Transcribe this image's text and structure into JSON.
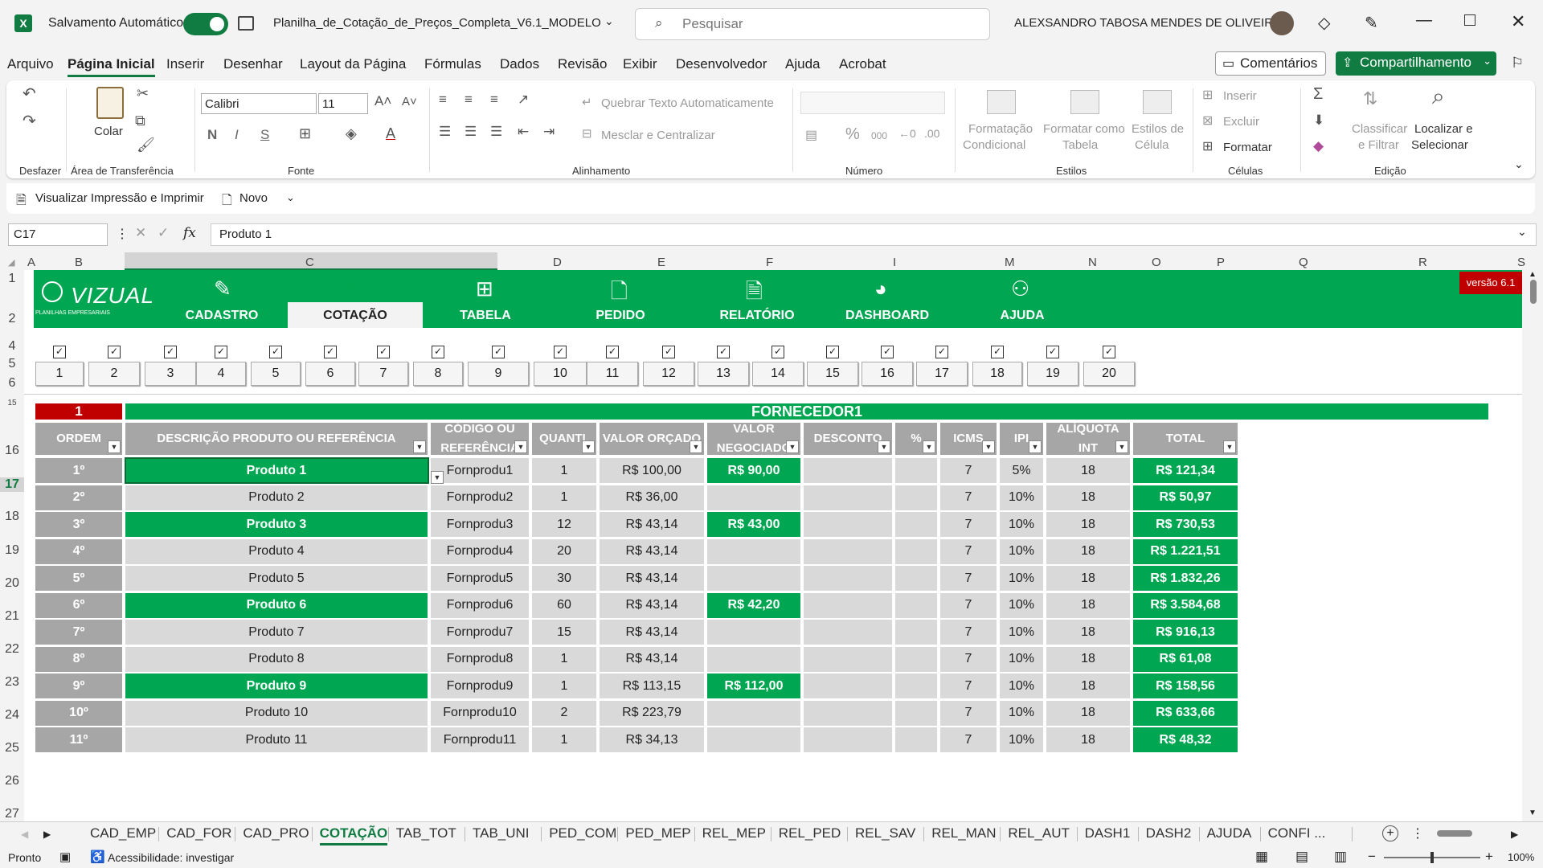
{
  "titlebar": {
    "autosave_label": "Salvamento Automático",
    "filename": "Planilha_de_Cotação_de_Preços_Completa_V6.1_MODELO.xl...",
    "search_placeholder": "Pesquisar",
    "user_name": "ALEXSANDRO TABOSA MENDES DE OLIVEIRA"
  },
  "menu": [
    "Arquivo",
    "Página Inicial",
    "Inserir",
    "Desenhar",
    "Layout da Página",
    "Fórmulas",
    "Dados",
    "Revisão",
    "Exibir",
    "Desenvolvedor",
    "Ajuda",
    "Acrobat"
  ],
  "menu_active": "Página Inicial",
  "actions": {
    "comments": "Comentários",
    "share": "Compartilhamento"
  },
  "ribbon": {
    "undo_group": "Desfazer",
    "clipboard": {
      "paste": "Colar",
      "group": "Área de Transferência"
    },
    "font": {
      "name": "Calibri",
      "size": "11",
      "group": "Fonte",
      "bold": "N",
      "italic": "I",
      "underline": "S"
    },
    "alignment": {
      "wrap": "Quebrar Texto Automaticamente",
      "merge": "Mesclar e Centralizar",
      "group": "Alinhamento"
    },
    "number": {
      "group": "Número",
      "percent": "%",
      "thousands": "000"
    },
    "styles": {
      "cond_line1": "Formatação",
      "cond_line2": "Condicional",
      "table_line1": "Formatar como",
      "table_line2": "Tabela",
      "cell_line1": "Estilos de",
      "cell_line2": "Célula",
      "group": "Estilos"
    },
    "cells": {
      "insert": "Inserir",
      "delete": "Excluir",
      "format": "Formatar",
      "group": "Células"
    },
    "editing": {
      "sort_line1": "Classificar",
      "sort_line2": "e Filtrar",
      "find_line1": "Localizar e",
      "find_line2": "Selecionar",
      "group": "Edição"
    }
  },
  "qat": {
    "print_preview": "Visualizar Impressão e Imprimir",
    "new": "Novo"
  },
  "formula": {
    "namebox": "C17",
    "fx": "fx",
    "value": "Produto 1"
  },
  "columns": [
    "A",
    "B",
    "C",
    "D",
    "E",
    "F",
    "I",
    "M",
    "N",
    "O",
    "P",
    "Q",
    "R",
    "S"
  ],
  "rows_left": [
    "1",
    "2",
    "4",
    "5",
    "6",
    "15",
    "16",
    "17",
    "18",
    "19",
    "20",
    "21",
    "22",
    "23",
    "24",
    "25",
    "26",
    "27"
  ],
  "nav": {
    "logo": "VIZUAL",
    "logo_sub": "PLANILHAS EMPRESARIAIS",
    "items": [
      "CADASTRO",
      "COTAÇÃO",
      "TABELA",
      "PEDIDO",
      "RELATÓRIO",
      "DASHBOARD",
      "AJUDA"
    ],
    "version": "versão 6.1"
  },
  "selectors": [
    "1",
    "2",
    "3",
    "4",
    "5",
    "6",
    "7",
    "8",
    "9",
    "10",
    "11",
    "12",
    "13",
    "14",
    "15",
    "16",
    "17",
    "18",
    "19",
    "20"
  ],
  "quote": {
    "supplier_number": "1",
    "supplier_title": "FORNECEDOR1",
    "headers": [
      "ORDEM",
      "DESCRIÇÃO PRODUTO OU REFERÊNCIA",
      "CÓDIGO OU REFERÊNCIA",
      "QUANTI.",
      "VALOR ORÇADO",
      "VALOR NEGOCIADO",
      "DESCONTO",
      "%",
      "ICMS",
      "IPI",
      "ALÍQUOTA INT",
      "TOTAL"
    ],
    "rows": [
      {
        "ordem": "1º",
        "desc": "Produto 1",
        "codigo": "Fornprodu1",
        "qtd": "1",
        "orcado": "R$ 100,00",
        "negociado": "R$ 90,00",
        "desconto": "",
        "pct": "",
        "icms": "7",
        "ipi": "5%",
        "aliq": "18",
        "total": "R$ 121,34",
        "hl": true
      },
      {
        "ordem": "2º",
        "desc": "Produto 2",
        "codigo": "Fornprodu2",
        "qtd": "1",
        "orcado": "R$ 36,00",
        "negociado": "",
        "desconto": "",
        "pct": "",
        "icms": "7",
        "ipi": "10%",
        "aliq": "18",
        "total": "R$ 50,97",
        "hl": false
      },
      {
        "ordem": "3º",
        "desc": "Produto 3",
        "codigo": "Fornprodu3",
        "qtd": "12",
        "orcado": "R$ 43,14",
        "negociado": "R$ 43,00",
        "desconto": "",
        "pct": "",
        "icms": "7",
        "ipi": "10%",
        "aliq": "18",
        "total": "R$ 730,53",
        "hl": true
      },
      {
        "ordem": "4º",
        "desc": "Produto 4",
        "codigo": "Fornprodu4",
        "qtd": "20",
        "orcado": "R$ 43,14",
        "negociado": "",
        "desconto": "",
        "pct": "",
        "icms": "7",
        "ipi": "10%",
        "aliq": "18",
        "total": "R$ 1.221,51",
        "hl": false
      },
      {
        "ordem": "5º",
        "desc": "Produto 5",
        "codigo": "Fornprodu5",
        "qtd": "30",
        "orcado": "R$ 43,14",
        "negociado": "",
        "desconto": "",
        "pct": "",
        "icms": "7",
        "ipi": "10%",
        "aliq": "18",
        "total": "R$ 1.832,26",
        "hl": false
      },
      {
        "ordem": "6º",
        "desc": "Produto 6",
        "codigo": "Fornprodu6",
        "qtd": "60",
        "orcado": "R$ 43,14",
        "negociado": "R$ 42,20",
        "desconto": "",
        "pct": "",
        "icms": "7",
        "ipi": "10%",
        "aliq": "18",
        "total": "R$ 3.584,68",
        "hl": true
      },
      {
        "ordem": "7º",
        "desc": "Produto 7",
        "codigo": "Fornprodu7",
        "qtd": "15",
        "orcado": "R$ 43,14",
        "negociado": "",
        "desconto": "",
        "pct": "",
        "icms": "7",
        "ipi": "10%",
        "aliq": "18",
        "total": "R$ 916,13",
        "hl": false
      },
      {
        "ordem": "8º",
        "desc": "Produto 8",
        "codigo": "Fornprodu8",
        "qtd": "1",
        "orcado": "R$ 43,14",
        "negociado": "",
        "desconto": "",
        "pct": "",
        "icms": "7",
        "ipi": "10%",
        "aliq": "18",
        "total": "R$ 61,08",
        "hl": false
      },
      {
        "ordem": "9º",
        "desc": "Produto 9",
        "codigo": "Fornprodu9",
        "qtd": "1",
        "orcado": "R$ 113,15",
        "negociado": "R$ 112,00",
        "desconto": "",
        "pct": "",
        "icms": "7",
        "ipi": "10%",
        "aliq": "18",
        "total": "R$ 158,56",
        "hl": true
      },
      {
        "ordem": "10º",
        "desc": "Produto 10",
        "codigo": "Fornprodu10",
        "qtd": "2",
        "orcado": "R$ 223,79",
        "negociado": "",
        "desconto": "",
        "pct": "",
        "icms": "7",
        "ipi": "10%",
        "aliq": "18",
        "total": "R$ 633,66",
        "hl": false
      },
      {
        "ordem": "11º",
        "desc": "Produto 11",
        "codigo": "Fornprodu11",
        "qtd": "1",
        "orcado": "R$ 34,13",
        "negociado": "",
        "desconto": "",
        "pct": "",
        "icms": "7",
        "ipi": "10%",
        "aliq": "18",
        "total": "R$ 48,32",
        "hl": false
      }
    ]
  },
  "sheet_tabs": [
    "CAD_EMP",
    "CAD_FOR",
    "CAD_PRO",
    "COTAÇÃO",
    "TAB_TOT",
    "TAB_UNI",
    "PED_COM",
    "PED_MEP",
    "REL_MEP",
    "REL_PED",
    "REL_SAV",
    "REL_MAN",
    "REL_AUT",
    "DASH1",
    "DASH2",
    "AJUDA",
    "CONFI ..."
  ],
  "active_tab": "COTAÇÃO",
  "status": {
    "ready": "Pronto",
    "accessibility": "Acessibilidade: investigar",
    "zoom": "100%"
  },
  "colors": {
    "brand_green": "#00a651",
    "excel_green": "#107c41",
    "header_gray": "#a6a6a6",
    "cell_gray": "#d9d9d9",
    "version_red": "#c00000"
  }
}
